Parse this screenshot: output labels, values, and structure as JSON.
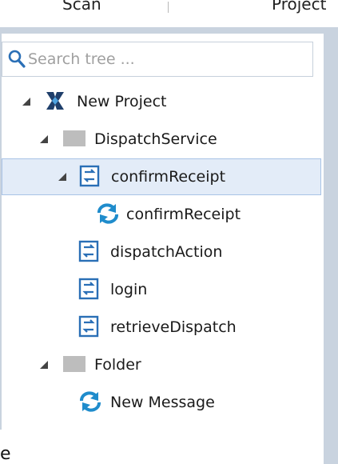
{
  "header": {
    "tab_left": "Scan",
    "tab_right": "Project"
  },
  "search": {
    "placeholder": "Search tree ..."
  },
  "tree": {
    "project": {
      "label": "New Project",
      "icon": "project-x-icon"
    },
    "dispatch_service": {
      "label": "DispatchService",
      "icon": "folder-icon"
    },
    "confirm_receipt": {
      "label": "confirmReceipt",
      "icon": "operation-icon"
    },
    "confirm_receipt_message": {
      "label": "confirmReceipt",
      "icon": "refresh-message-icon"
    },
    "dispatch_action": {
      "label": "dispatchAction",
      "icon": "operation-icon"
    },
    "login": {
      "label": "login",
      "icon": "operation-icon"
    },
    "retrieve_dispatch": {
      "label": "retrieveDispatch",
      "icon": "operation-icon"
    },
    "folder": {
      "label": "Folder",
      "icon": "folder-icon"
    },
    "new_message": {
      "label": "New Message",
      "icon": "refresh-message-icon"
    }
  },
  "footer": {
    "partial_text": "e"
  },
  "colors": {
    "frame": "#c9d3df",
    "selection_bg": "#e3ecf8",
    "selection_border": "#a9c3e6",
    "folder_gray": "#bdbdbd",
    "operation_blue": "#2a6fb6",
    "project_navy": "#1f3f6b",
    "refresh_blue": "#1f8ccc"
  }
}
